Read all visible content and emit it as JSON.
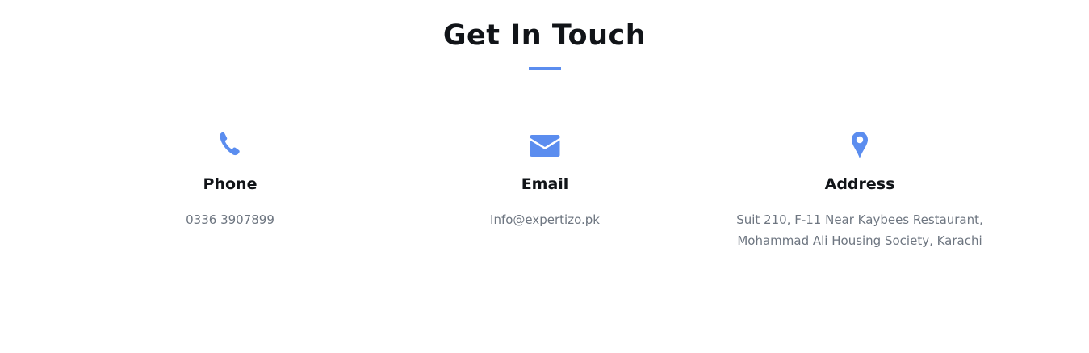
{
  "section": {
    "title": "Get In Touch",
    "accent_color": "#5b8def"
  },
  "contacts": [
    {
      "icon": "phone-icon",
      "heading": "Phone",
      "lines": [
        "0336 3907899"
      ]
    },
    {
      "icon": "envelope-icon",
      "heading": "Email",
      "lines": [
        "Info@expertizo.pk"
      ]
    },
    {
      "icon": "map-pin-icon",
      "heading": "Address",
      "lines": [
        "Suit 210, F-11 Near Kaybees Restaurant,",
        "Mohammad Ali Housing Society, Karachi"
      ]
    }
  ]
}
